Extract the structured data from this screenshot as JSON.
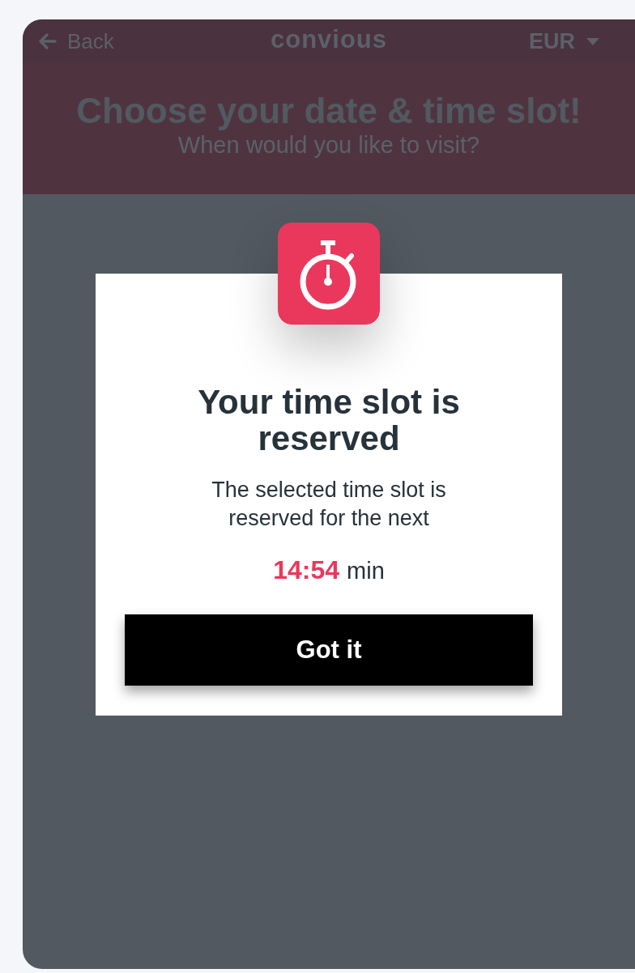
{
  "top_bar": {
    "back_label": "Back",
    "logo": "convious",
    "currency": "EUR"
  },
  "header": {
    "title": "Choose your date & time slot!",
    "subtitle": "When would you like to visit?"
  },
  "dialog": {
    "title": "Your time slot is reserved",
    "message": "The selected time slot is reserved for the next",
    "timer": "14:54",
    "timer_unit": "min",
    "button": "Got it"
  }
}
